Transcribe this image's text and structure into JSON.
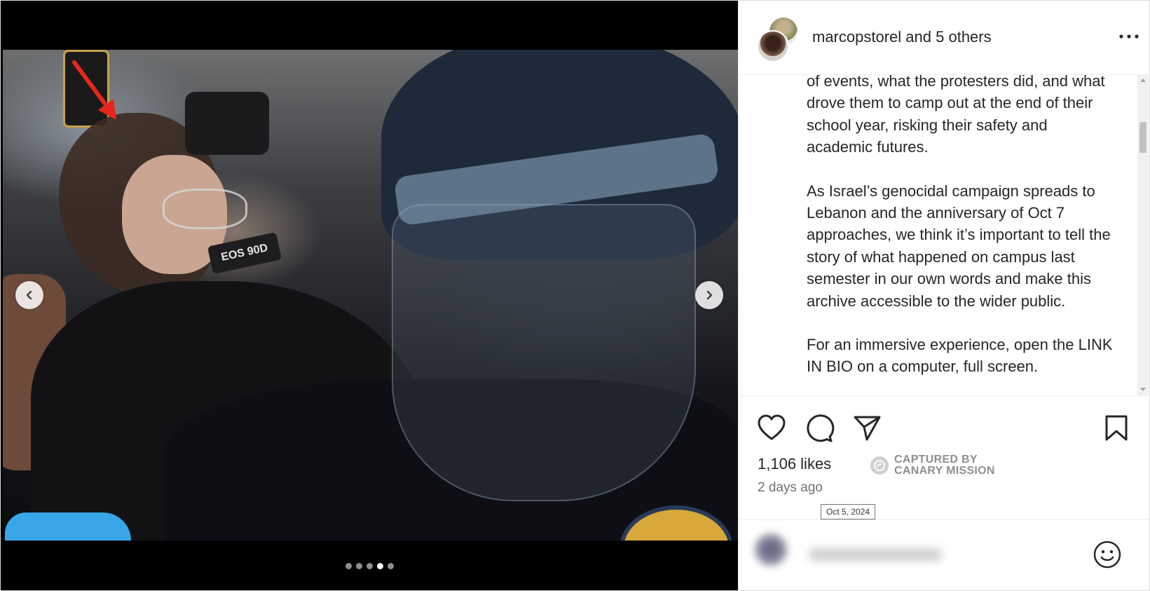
{
  "post": {
    "author": "marcopstorel",
    "coauthor_joiner": "and",
    "coauthor_count_label": "5 others",
    "caption_paragraphs": [
      "of events, what the protesters did, and what drove them to camp out at the end of their school year, risking their safety and academic futures.",
      "As Israel’s genocidal campaign spreads to Lebanon and the anniversary of Oct 7 approaches, we think it’s important to tell the story of what happened on campus last semester in our own words and make this archive accessible to the wider public.",
      "For an immersive experience, open the LINK IN BIO on a computer, full screen."
    ],
    "likes": "1,106 likes",
    "time_ago": "2 days ago",
    "date_tooltip": "Oct 5, 2024"
  },
  "media": {
    "strap_text": "EOS 90D",
    "slide_count": 5,
    "active_slide_index": 3
  },
  "watermark": {
    "line1": "CAPTURED BY",
    "line2": "CANARY MISSION"
  },
  "colors": {
    "text": "#262626",
    "muted": "#737373",
    "border": "#efefef",
    "media_bg": "#000000"
  },
  "icons": [
    "chevron-left-icon",
    "chevron-right-icon",
    "more-icon",
    "heart-icon",
    "comment-icon",
    "share-icon",
    "bookmark-icon",
    "emoji-icon",
    "arrow-annotation-icon"
  ]
}
